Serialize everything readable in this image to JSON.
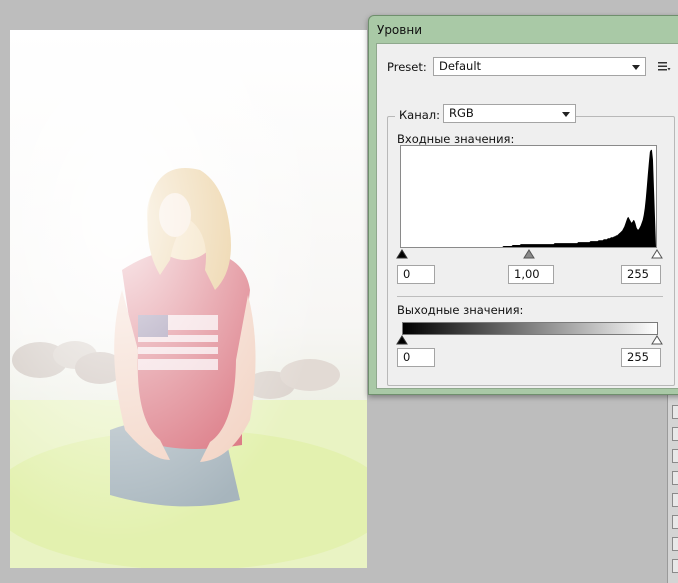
{
  "dialog": {
    "title": "Уровни",
    "preset_label": "Preset:",
    "preset_value": "Default",
    "channel_label": "Канал:",
    "channel_value": "RGB",
    "input_label": "Входные значения:",
    "input_black": "0",
    "input_gamma": "1,00",
    "input_white": "255",
    "output_label": "Выходные значения:",
    "output_black": "0",
    "output_white": "255",
    "histogram_profile": [
      0,
      0,
      0,
      0,
      0,
      0,
      0,
      0,
      0,
      0,
      0,
      0,
      0,
      0,
      0,
      0,
      0,
      0,
      0,
      0,
      0,
      0,
      0,
      0,
      0,
      0,
      0,
      0,
      0,
      0,
      0,
      0,
      0,
      0,
      0,
      0,
      0,
      0,
      0,
      0,
      0,
      0,
      0,
      0,
      0,
      0,
      0,
      0,
      0,
      0,
      0,
      0,
      0,
      0,
      0,
      0,
      0,
      0,
      0,
      0,
      0,
      0,
      0,
      0,
      0,
      0,
      0,
      0,
      0,
      0,
      0,
      0,
      0,
      0,
      0,
      0,
      0,
      0,
      0,
      0,
      0,
      0,
      0,
      0,
      0,
      0,
      0,
      0,
      0,
      0,
      0,
      0,
      0,
      0,
      0,
      0,
      0,
      0,
      0,
      0.01,
      0.01,
      0.01,
      0.01,
      0.01,
      0.01,
      0.01,
      0.01,
      0.01,
      0.02,
      0.02,
      0.02,
      0.02,
      0.02,
      0.02,
      0.02,
      0.02,
      0.03,
      0.03,
      0.03,
      0.03,
      0.03,
      0.03,
      0.03,
      0.03,
      0.03,
      0.03,
      0.03,
      0.03,
      0.03,
      0.03,
      0.03,
      0.03,
      0.03,
      0.03,
      0.03,
      0.03,
      0.03,
      0.03,
      0.03,
      0.03,
      0.03,
      0.03,
      0.03,
      0.03,
      0.03,
      0.03,
      0.03,
      0.03,
      0.03,
      0.04,
      0.04,
      0.04,
      0.04,
      0.04,
      0.04,
      0.04,
      0.04,
      0.04,
      0.04,
      0.04,
      0.04,
      0.04,
      0.04,
      0.04,
      0.04,
      0.04,
      0.04,
      0.04,
      0.04,
      0.04,
      0.04,
      0.04,
      0.05,
      0.05,
      0.05,
      0.05,
      0.05,
      0.05,
      0.05,
      0.05,
      0.05,
      0.05,
      0.05,
      0.05,
      0.06,
      0.06,
      0.06,
      0.06,
      0.06,
      0.06,
      0.06,
      0.06,
      0.07,
      0.07,
      0.07,
      0.07,
      0.07,
      0.08,
      0.08,
      0.08,
      0.08,
      0.09,
      0.09,
      0.09,
      0.1,
      0.1,
      0.1,
      0.11,
      0.11,
      0.12,
      0.12,
      0.13,
      0.14,
      0.15,
      0.16,
      0.17,
      0.19,
      0.21,
      0.24,
      0.27,
      0.3,
      0.31,
      0.29,
      0.27,
      0.25,
      0.26,
      0.28,
      0.27,
      0.24,
      0.2,
      0.18,
      0.18,
      0.2,
      0.22,
      0.25,
      0.28,
      0.33,
      0.4,
      0.5,
      0.62,
      0.75,
      0.87,
      0.98,
      1.0,
      1.0,
      0.9,
      0.6,
      0.3
    ]
  }
}
